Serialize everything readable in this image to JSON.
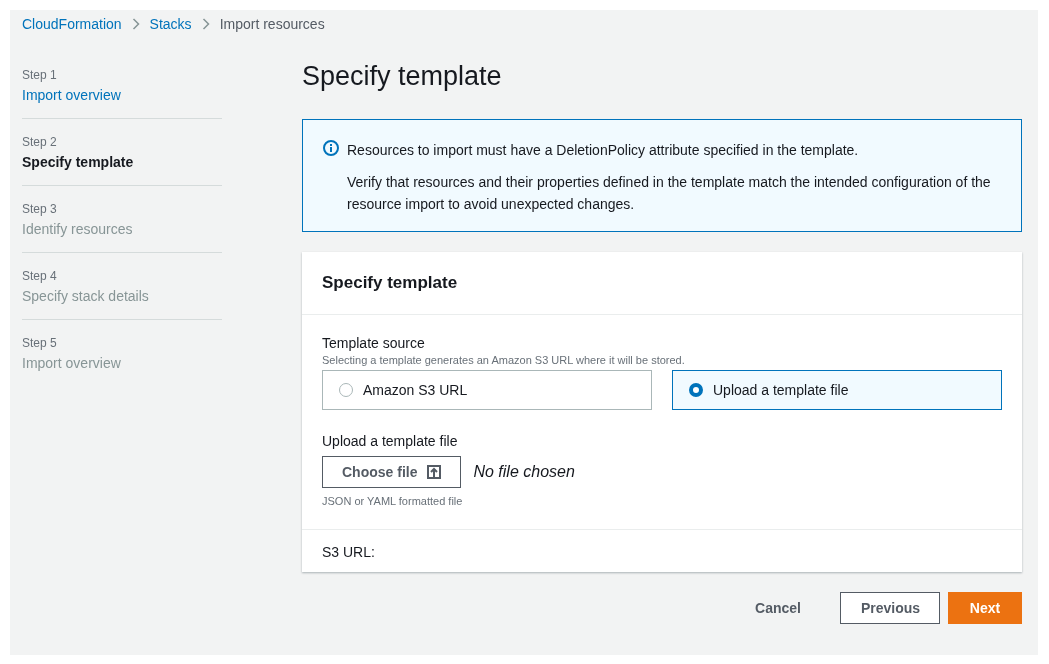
{
  "breadcrumbs": [
    {
      "label": "CloudFormation",
      "link": true
    },
    {
      "label": "Stacks",
      "link": true
    },
    {
      "label": "Import resources",
      "link": false
    }
  ],
  "steps": [
    {
      "step": "Step 1",
      "label": "Import overview",
      "selected": false,
      "disabled": false
    },
    {
      "step": "Step 2",
      "label": "Specify template",
      "selected": true,
      "disabled": false
    },
    {
      "step": "Step 3",
      "label": "Identify resources",
      "selected": false,
      "disabled": true
    },
    {
      "step": "Step 4",
      "label": "Specify stack details",
      "selected": false,
      "disabled": true
    },
    {
      "step": "Step 5",
      "label": "Import overview",
      "selected": false,
      "disabled": true
    }
  ],
  "page_title": "Specify template",
  "info_alert": {
    "message": "Resources to import must have a DeletionPolicy attribute specified in the template.",
    "detail": "Verify that resources and their properties defined in the template match the intended configuration of the resource import to avoid unexpected changes."
  },
  "panel": {
    "title": "Specify template",
    "template_source": {
      "label": "Template source",
      "description": "Selecting a template generates an Amazon S3 URL where it will be stored.",
      "options": [
        {
          "label": "Amazon S3 URL",
          "selected": false
        },
        {
          "label": "Upload a template file",
          "selected": true
        }
      ]
    },
    "upload": {
      "label": "Upload a template file",
      "button": "Choose file",
      "status": "No file chosen",
      "hint": "JSON or YAML formatted file"
    },
    "s3_url_label": "S3 URL:"
  },
  "buttons": {
    "cancel": "Cancel",
    "previous": "Previous",
    "next": "Next"
  }
}
